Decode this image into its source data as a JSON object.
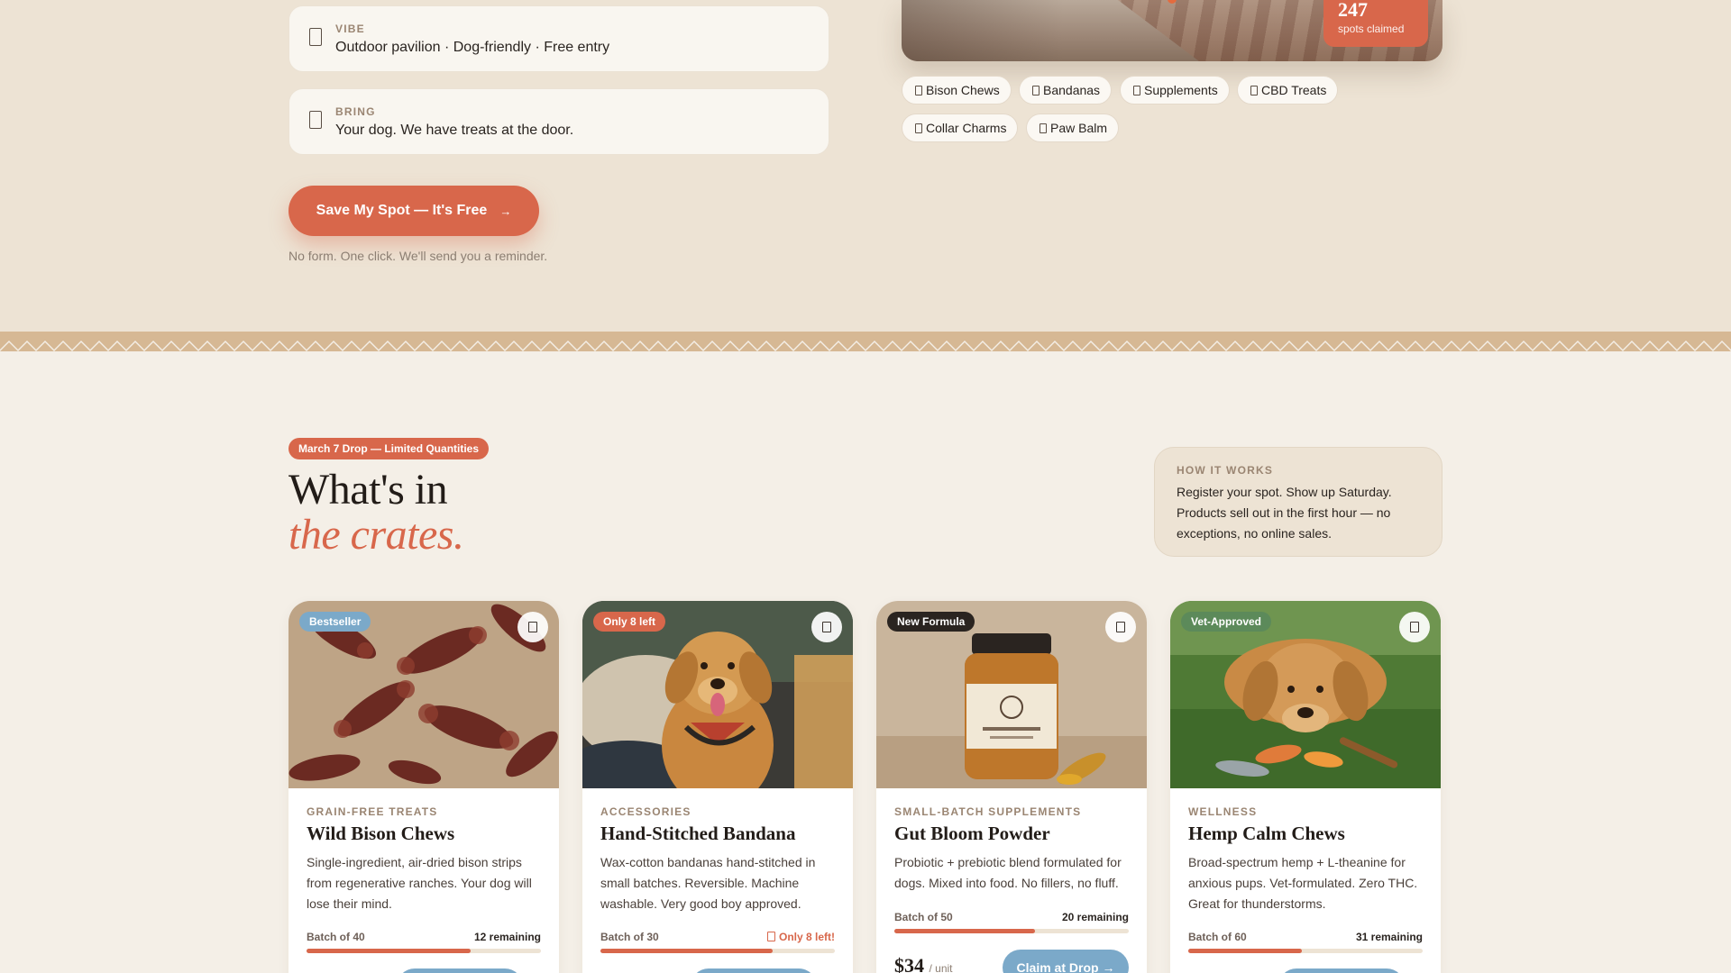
{
  "event": {
    "vibe_label": "VIBE",
    "vibe_value": "Outdoor pavilion · Dog-friendly · Free entry",
    "bring_label": "BRING",
    "bring_value": "Your dog. We have treats at the door.",
    "cta_label": "Save My Spot — It's Free",
    "cta_arrow": "→",
    "cta_note": "No form. One click. We'll send you a reminder.",
    "spots_count": "247",
    "spots_label": "spots claimed",
    "chips": [
      "Bison Chews",
      "Bandanas",
      "Supplements",
      "CBD Treats",
      "Collar Charms",
      "Paw Balm"
    ]
  },
  "products_section": {
    "drop_badge": "March 7 Drop — Limited Quantities",
    "title_line1": "What's in",
    "title_line2": "the crates.",
    "how_label": "HOW IT WORKS",
    "how_text": "Register your spot. Show up Saturday. Products sell out in the first hour — no exceptions, no online sales."
  },
  "products": [
    {
      "badge": "Bestseller",
      "badge_color": "#7ba9c9",
      "category": "GRAIN-FREE TREATS",
      "name": "Wild Bison Chews",
      "description": "Single-ingredient, air-dried bison strips from regenerative ranches. Your dog will lose their mind.",
      "batch": "Batch of 40",
      "remaining": "12 remaining",
      "claimed_fraction": 0.7
    },
    {
      "badge": "Only 8 left",
      "badge_color": "#d8674b",
      "category": "ACCESSORIES",
      "name": "Hand-Stitched Bandana",
      "description": "Wax-cotton bandanas hand-stitched in small batches. Reversible. Machine washable. Very good boy approved.",
      "batch": "Batch of 30",
      "remaining": "Only 8 left!",
      "claimed_fraction": 0.733
    },
    {
      "badge": "New Formula",
      "badge_color": "#2a2420",
      "category": "SMALL-BATCH SUPPLEMENTS",
      "name": "Gut Bloom Powder",
      "description": "Probiotic + prebiotic blend formulated for dogs. Mixed into food. No fillers, no fluff.",
      "batch": "Batch of 50",
      "remaining": "20 remaining",
      "claimed_fraction": 0.6,
      "price": "$34",
      "price_unit": "/ unit",
      "claim_label": "Claim at Drop →"
    },
    {
      "badge": "Vet-Approved",
      "badge_color": "#5c8a5a",
      "category": "WELLNESS",
      "name": "Hemp Calm Chews",
      "description": "Broad-spectrum hemp + L-theanine for anxious pups. Vet-formulated. Zero THC. Great for thunderstorms.",
      "batch": "Batch of 60",
      "remaining": "31 remaining",
      "claimed_fraction": 0.483
    }
  ],
  "colors": {
    "accent": "#d8674b",
    "secondary": "#7ba9c9",
    "sand": "#ede3d4",
    "cream": "#f4efe7"
  },
  "icons": {
    "info": "document-icon",
    "favorite": "bookmark-icon",
    "chip": "tag-icon"
  }
}
